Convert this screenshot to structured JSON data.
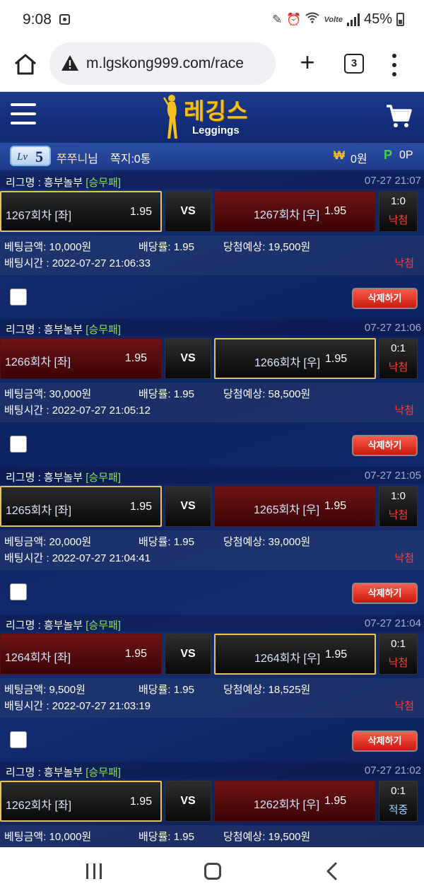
{
  "status_bar": {
    "time": "9:08",
    "network": "Volte",
    "battery": "45%"
  },
  "browser": {
    "url": "m.lgskong999.com/race",
    "tab_count": "3"
  },
  "site": {
    "logo_korean": "레깅스",
    "logo_english": "Leggings"
  },
  "user": {
    "level_prefix": "Lv",
    "level": "5",
    "name": "쭈쭈니",
    "name_suffix": "님",
    "notes": "쪽지:0통",
    "money_symbol": "₩",
    "money": "0원",
    "point_symbol": "P",
    "points": "0P"
  },
  "bets": [
    {
      "league": "리그명 : 흥부놀부",
      "bet_type": "[승무패]",
      "datetime": "07-27 21:07",
      "home": "1267회차 [좌]",
      "home_odds": "1.95",
      "vs": "VS",
      "away": "1267회차 [우]",
      "away_odds": "1.95",
      "score": "1:0",
      "result": "낙첨",
      "amount": "베팅금액: 10,000원",
      "rate": "배당률: 1.95",
      "expected": "당첨예상: 19,500원",
      "bet_time": "배팅시간 : 2022-07-27 21:06:33",
      "status": "낙첨",
      "delete_label": "삭제하기"
    },
    {
      "league": "리그명 : 흥부놀부",
      "bet_type": "[승무패]",
      "datetime": "07-27 21:06",
      "home": "1266회차 [좌]",
      "home_odds": "1.95",
      "vs": "VS",
      "away": "1266회차 [우]",
      "away_odds": "1.95",
      "score": "0:1",
      "result": "낙첨",
      "amount": "베팅금액: 30,000원",
      "rate": "배당률: 1.95",
      "expected": "당첨예상: 58,500원",
      "bet_time": "배팅시간 : 2022-07-27 21:05:12",
      "status": "낙첨",
      "delete_label": "삭제하기"
    },
    {
      "league": "리그명 : 흥부놀부",
      "bet_type": "[승무패]",
      "datetime": "07-27 21:05",
      "home": "1265회차 [좌]",
      "home_odds": "1.95",
      "vs": "VS",
      "away": "1265회차 [우]",
      "away_odds": "1.95",
      "score": "1:0",
      "result": "낙첨",
      "amount": "베팅금액: 20,000원",
      "rate": "배당률: 1.95",
      "expected": "당첨예상: 39,000원",
      "bet_time": "배팅시간 : 2022-07-27 21:04:41",
      "status": "낙첨",
      "delete_label": "삭제하기"
    },
    {
      "league": "리그명 : 흥부놀부",
      "bet_type": "[승무패]",
      "datetime": "07-27 21:04",
      "home": "1264회차 [좌]",
      "home_odds": "1.95",
      "vs": "VS",
      "away": "1264회차 [우]",
      "away_odds": "1.95",
      "score": "0:1",
      "result": "낙첨",
      "amount": "베팅금액: 9,500원",
      "rate": "배당률: 1.95",
      "expected": "당첨예상: 18,525원",
      "bet_time": "배팅시간 : 2022-07-27 21:03:19",
      "status": "낙첨",
      "delete_label": "삭제하기"
    },
    {
      "league": "리그명 : 흥부놀부",
      "bet_type": "[승무패]",
      "datetime": "07-27 21:02",
      "home": "1262회차 [좌]",
      "home_odds": "1.95",
      "vs": "VS",
      "away": "1262회차 [우]",
      "away_odds": "1.95",
      "score": "0:1",
      "result": "적중",
      "amount": "베팅금액: 10,000원",
      "rate": "배당률: 1.95",
      "expected": "당첨예상: 19,500원"
    }
  ]
}
